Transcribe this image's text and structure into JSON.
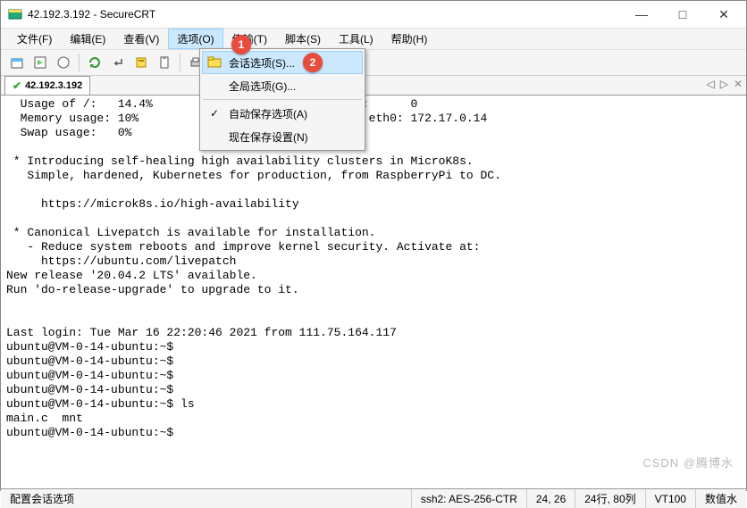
{
  "title": "42.192.3.192 - SecureCRT",
  "menubar": [
    "文件(F)",
    "编辑(E)",
    "查看(V)",
    "选项(O)",
    "传输(T)",
    "脚本(S)",
    "工具(L)",
    "帮助(H)"
  ],
  "menubar_open_index": 3,
  "dropdown": {
    "items": [
      {
        "label": "会话选项(S)...",
        "icon": "folder",
        "hl": true
      },
      {
        "label": "全局选项(G)...",
        "icon": ""
      },
      {
        "sep": true
      },
      {
        "label": "自动保存选项(A)",
        "check": true
      },
      {
        "label": "现在保存设置(N)"
      }
    ]
  },
  "tab": {
    "label": "42.192.3.192"
  },
  "terminal_lines": [
    "  Usage of /:   14.4%                     logged in:      0",
    "  Memory usage: 10%                       dress for eth0: 172.17.0.14",
    "  Swap usage:   0%",
    "",
    " * Introducing self-healing high availability clusters in MicroK8s.",
    "   Simple, hardened, Kubernetes for production, from RaspberryPi to DC.",
    "",
    "     https://microk8s.io/high-availability",
    "",
    " * Canonical Livepatch is available for installation.",
    "   - Reduce system reboots and improve kernel security. Activate at:",
    "     https://ubuntu.com/livepatch",
    "New release '20.04.2 LTS' available.",
    "Run 'do-release-upgrade' to upgrade to it.",
    "",
    "",
    "Last login: Tue Mar 16 22:20:46 2021 from 111.75.164.117",
    "ubuntu@VM-0-14-ubuntu:~$",
    "ubuntu@VM-0-14-ubuntu:~$",
    "ubuntu@VM-0-14-ubuntu:~$",
    "ubuntu@VM-0-14-ubuntu:~$",
    "ubuntu@VM-0-14-ubuntu:~$ ls",
    "main.c  mnt",
    "ubuntu@VM-0-14-ubuntu:~$"
  ],
  "statusbar": {
    "left": "配置会话选项",
    "proto": "ssh2: AES-256-CTR",
    "pos": "24, 26",
    "size": "24行, 80列",
    "term": "VT100",
    "cap": "数值水"
  },
  "annotations": {
    "one": "1",
    "two": "2"
  },
  "watermark": "CSDN @腾博水"
}
